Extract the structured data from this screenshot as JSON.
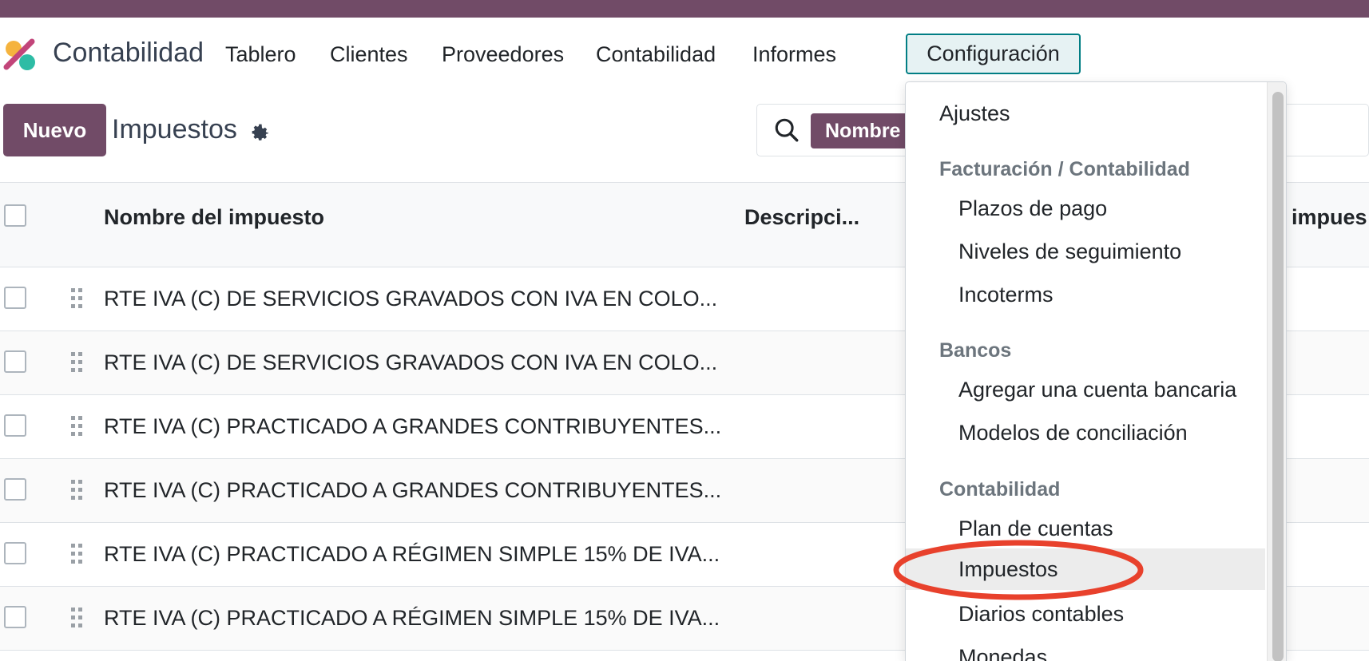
{
  "app": {
    "name": "Contabilidad"
  },
  "nav": {
    "items": [
      "Tablero",
      "Clientes",
      "Proveedores",
      "Contabilidad",
      "Informes"
    ],
    "active": "Configuración"
  },
  "control": {
    "new_label": "Nuevo",
    "title": "Impuestos",
    "facet": "Nombre"
  },
  "table": {
    "headers": {
      "name": "Nombre del impuesto",
      "description": "Descripci...",
      "scope_partial": "impues"
    },
    "rows": [
      "RTE IVA (C) DE SERVICIOS GRAVADOS CON IVA EN COLO...",
      "RTE IVA (C) DE SERVICIOS GRAVADOS CON IVA EN COLO...",
      "RTE IVA (C) PRACTICADO A GRANDES CONTRIBUYENTES...",
      "RTE IVA (C) PRACTICADO A GRANDES CONTRIBUYENTES...",
      "RTE IVA (C) PRACTICADO A RÉGIMEN SIMPLE 15% DE IVA...",
      "RTE IVA (C) PRACTICADO A RÉGIMEN SIMPLE 15% DE IVA..."
    ]
  },
  "dropdown": {
    "settings": "Ajustes",
    "sections": [
      {
        "header": "Facturación / Contabilidad",
        "items": [
          "Plazos de pago",
          "Niveles de seguimiento",
          "Incoterms"
        ]
      },
      {
        "header": "Bancos",
        "items": [
          "Agregar una cuenta bancaria",
          "Modelos de conciliación"
        ]
      },
      {
        "header": "Contabilidad",
        "items": [
          "Plan de cuentas",
          "Impuestos",
          "Diarios contables",
          "Monedas"
        ]
      }
    ]
  },
  "colors": {
    "brand": "#714B67",
    "teal": "#017E84",
    "highlight": "#E8412C"
  },
  "icons": [
    "app-logo-icon",
    "gear-icon",
    "search-icon",
    "drag-handle-icon"
  ]
}
